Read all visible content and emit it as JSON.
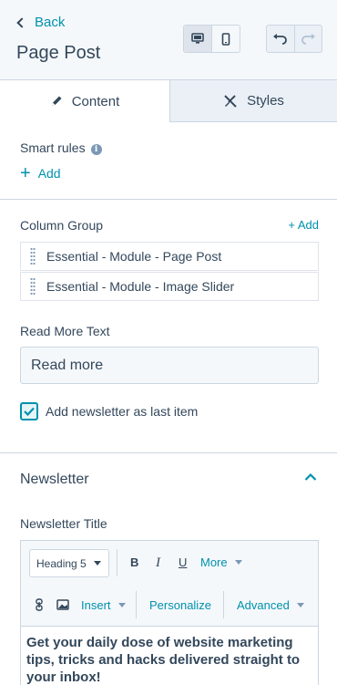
{
  "header": {
    "back_label": "Back",
    "title": "Page Post",
    "device_buttons": [
      "desktop-icon",
      "mobile-icon"
    ],
    "history_buttons": [
      "undo-icon",
      "redo-icon"
    ]
  },
  "tabs": [
    {
      "label": "Content",
      "icon": "pencil-icon",
      "active": true
    },
    {
      "label": "Styles",
      "icon": "brush-icon",
      "active": false
    }
  ],
  "smart_rules": {
    "label": "Smart rules",
    "add_label": "Add"
  },
  "column_group": {
    "label": "Column Group",
    "add_label": "+ Add",
    "items": [
      "Essential - Module - Page Post",
      "Essential - Module - Image Slider"
    ]
  },
  "read_more": {
    "label": "Read More Text",
    "value": "Read more"
  },
  "newsletter_checkbox": {
    "label": "Add newsletter as last item",
    "checked": true
  },
  "newsletter": {
    "section_title": "Newsletter",
    "title_label": "Newsletter Title",
    "editor": {
      "style_select": "Heading 5",
      "bold": "B",
      "italic": "I",
      "underline": "U",
      "more": "More",
      "insert": "Insert",
      "personalize": "Personalize",
      "advanced": "Advanced",
      "content": "Get your daily dose of website marketing tips, tricks and hacks delivered straight to your inbox!"
    }
  },
  "colors": {
    "accent": "#0091ae",
    "text": "#33475b",
    "border": "#cbd6e2",
    "background": "#f5f8fa"
  }
}
